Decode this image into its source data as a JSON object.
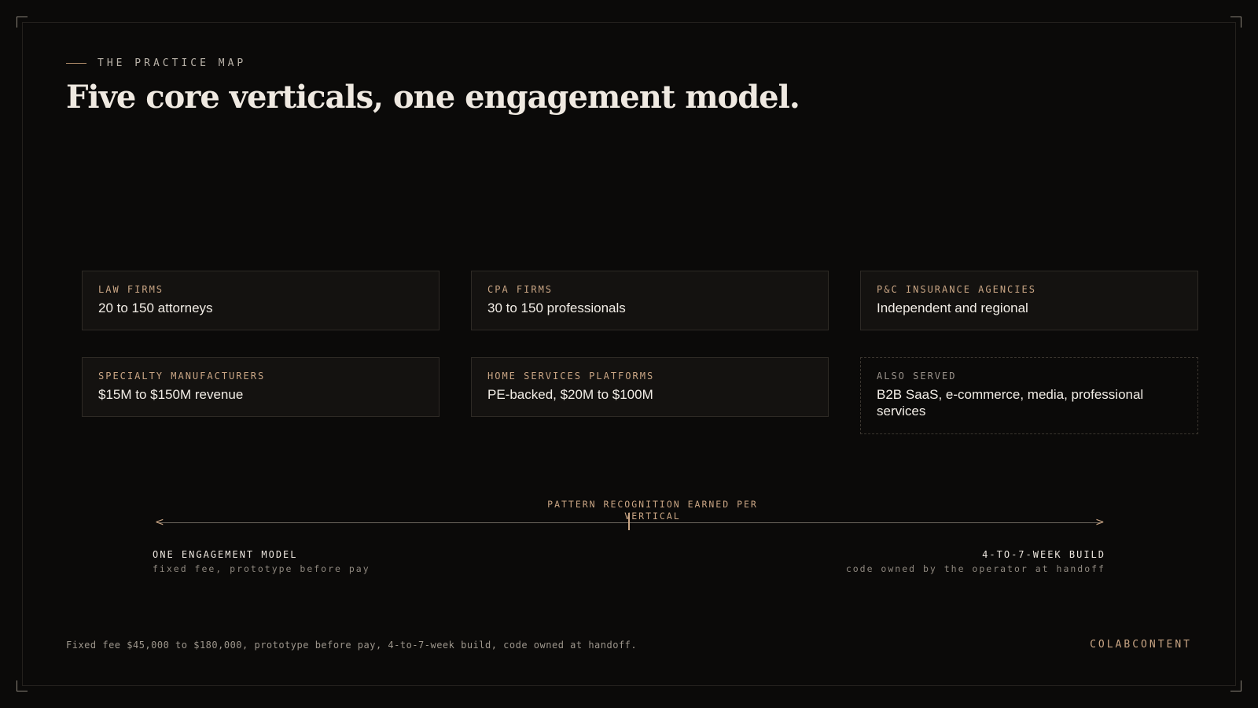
{
  "eyebrow": "THE PRACTICE MAP",
  "title": "Five core verticals, one engagement model.",
  "cards": [
    {
      "label": "LAW FIRMS",
      "value": "20 to 150 attorneys"
    },
    {
      "label": "CPA FIRMS",
      "value": "30 to 150 professionals"
    },
    {
      "label": "P&C INSURANCE AGENCIES",
      "value": "Independent and regional"
    },
    {
      "label": "SPECIALTY MANUFACTURERS",
      "value": "$15M to $150M revenue"
    },
    {
      "label": "HOME SERVICES PLATFORMS",
      "value": "PE-backed, $20M to $100M"
    },
    {
      "label": "ALSO SERVED",
      "value": "B2B SaaS, e-commerce, media, professional services"
    }
  ],
  "axis": {
    "center_label": "PATTERN RECOGNITION EARNED PER VERTICAL",
    "left_title": "ONE ENGAGEMENT MODEL",
    "left_sub": "fixed fee, prototype before pay",
    "right_title": "4-TO-7-WEEK BUILD",
    "right_sub": "code owned by the operator at handoff"
  },
  "footer": "Fixed fee $45,000 to $180,000, prototype before pay, 4-to-7-week build, code owned at handoff.",
  "brand": "COLABCONTENT",
  "colors": {
    "accent": "#c9a584",
    "background": "#0b0a09",
    "text": "#efe9e1"
  }
}
